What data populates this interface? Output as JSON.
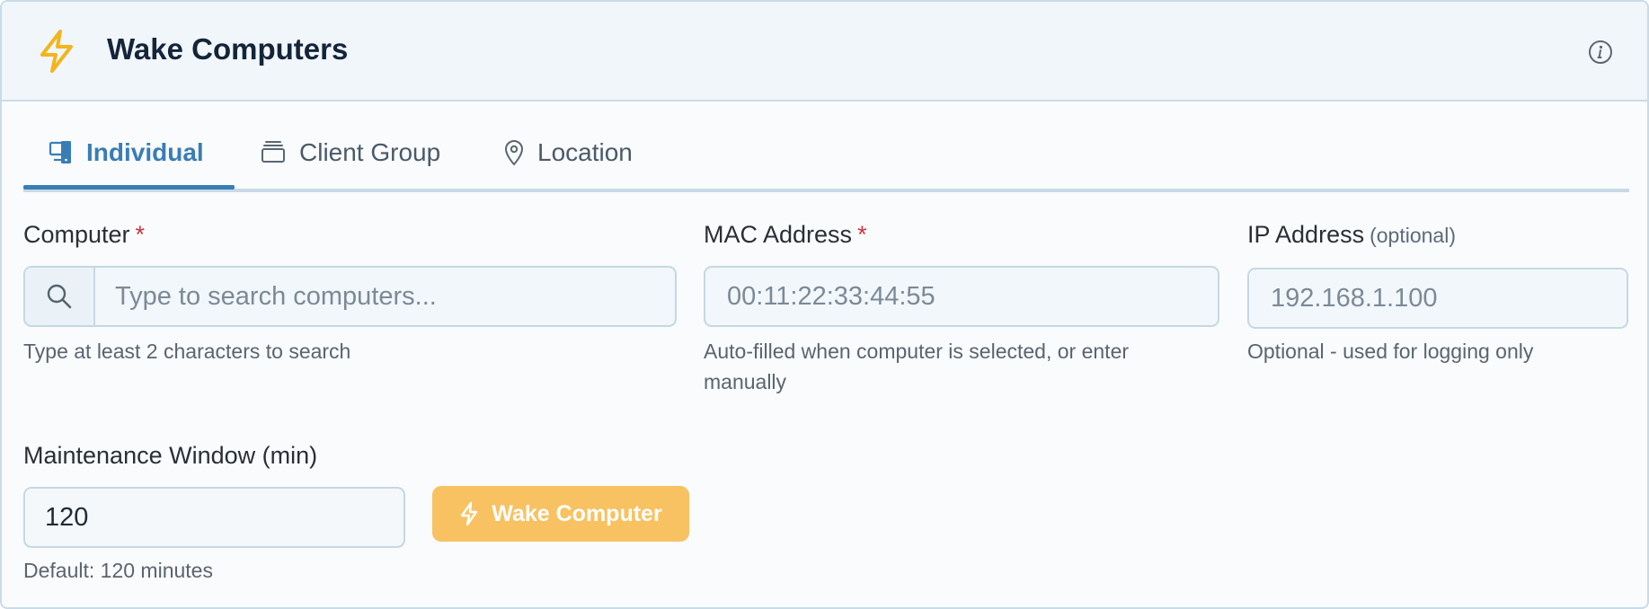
{
  "header": {
    "title": "Wake Computers",
    "icon": "lightning-bolt-icon",
    "info_icon": "info-icon",
    "accent_color": "#f2b51c"
  },
  "tabs": [
    {
      "label": "Individual",
      "icon": "computer-icon",
      "active": true
    },
    {
      "label": "Client Group",
      "icon": "group-stack-icon",
      "active": false
    },
    {
      "label": "Location",
      "icon": "location-pin-icon",
      "active": false
    }
  ],
  "form": {
    "computer": {
      "label": "Computer",
      "required_mark": "*",
      "placeholder": "Type to search computers...",
      "help": "Type at least 2 characters to search"
    },
    "mac": {
      "label": "MAC Address",
      "required_mark": "*",
      "placeholder": "00:11:22:33:44:55",
      "help": "Auto-filled when computer is selected, or enter manually"
    },
    "ip": {
      "label": "IP Address",
      "optional_note": "(optional)",
      "placeholder": "192.168.1.100",
      "help": "Optional - used for logging only"
    },
    "maintenance": {
      "label": "Maintenance Window (min)",
      "value": "120",
      "help": "Default: 120 minutes"
    }
  },
  "actions": {
    "wake_label": "Wake Computer",
    "wake_color": "#f8c262"
  }
}
